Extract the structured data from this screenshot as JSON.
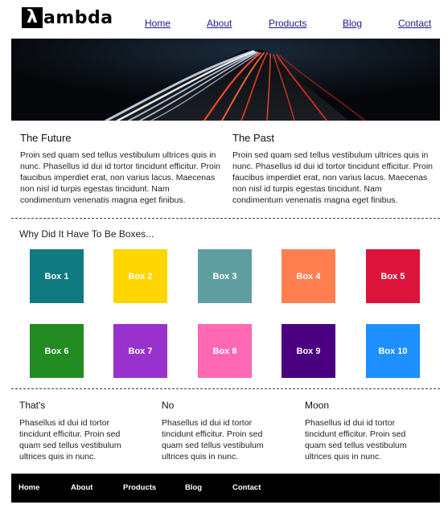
{
  "brand": {
    "logo_mark": "λ",
    "logo_text": "ambda"
  },
  "nav": {
    "items": [
      {
        "label": "Home"
      },
      {
        "label": "About"
      },
      {
        "label": "Products"
      },
      {
        "label": "Blog"
      },
      {
        "label": "Contact"
      }
    ]
  },
  "intro": {
    "future": {
      "title": "The Future",
      "text": "Proin sed quam sed tellus vestibulum ultrices quis in nunc. Phasellus id dui id tortor tincidunt efficitur. Proin faucibus imperdiet erat, non varius lacus. Maecenas non nisl id turpis egestas tincidunt. Nam condimentum venenatis magna eget finibus."
    },
    "past": {
      "title": "The Past",
      "text": "Proin sed quam sed tellus vestibulum ultrices quis in nunc. Phasellus id dui id tortor tincidunt efficitur. Proin faucibus imperdiet erat, non varius lacus. Maecenas non nisl id turpis egestas tincidunt. Nam condimentum venenatis magna eget finibus."
    }
  },
  "boxes_section": {
    "title": "Why Did It Have To Be Boxes...",
    "boxes": [
      {
        "label": "Box 1",
        "color": "#0f7b80"
      },
      {
        "label": "Box 2",
        "color": "#ffd600"
      },
      {
        "label": "Box 3",
        "color": "#5f9ea0"
      },
      {
        "label": "Box 4",
        "color": "#ff7f50"
      },
      {
        "label": "Box 5",
        "color": "#dc143c"
      },
      {
        "label": "Box 6",
        "color": "#228b22"
      },
      {
        "label": "Box 7",
        "color": "#9932cc"
      },
      {
        "label": "Box 8",
        "color": "#ff69b4"
      },
      {
        "label": "Box 9",
        "color": "#4b0082"
      },
      {
        "label": "Box 10",
        "color": "#1e90ff"
      }
    ]
  },
  "bottom": {
    "cols": [
      {
        "title": "That's",
        "text": "Phasellus id dui id tortor tincidunt efficitur. Proin sed quam sed tellus vestibulum ultrices quis in nunc."
      },
      {
        "title": "No",
        "text": "Phasellus id dui id tortor tincidunt efficitur. Proin sed quam sed tellus vestibulum ultrices quis in nunc."
      },
      {
        "title": "Moon",
        "text": "Phasellus id dui id tortor tincidunt efficitur. Proin sed quam sed tellus vestibulum ultrices quis in nunc."
      }
    ]
  },
  "footer": {
    "items": [
      {
        "label": "Home"
      },
      {
        "label": "About"
      },
      {
        "label": "Products"
      },
      {
        "label": "Blog"
      },
      {
        "label": "Contact"
      }
    ]
  },
  "colors": {
    "footer_bg": "#000000",
    "nav_link": "#1a1a8c"
  }
}
